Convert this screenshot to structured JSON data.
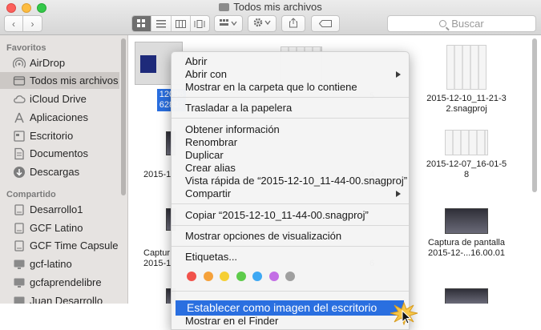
{
  "window": {
    "title": "Todos mis archivos"
  },
  "toolbar": {
    "back_icon": "chevron-left-icon",
    "forward_icon": "chevron-right-icon",
    "views": [
      "icon-view-icon",
      "list-view-icon",
      "column-view-icon",
      "coverflow-view-icon"
    ],
    "arrange_icon": "arrange-icon",
    "action_icon": "gear-icon",
    "share_icon": "share-icon",
    "tag_icon": "tag-icon",
    "search_placeholder": "Buscar"
  },
  "sidebar": {
    "favorites_heading": "Favoritos",
    "favorites": [
      {
        "label": "AirDrop",
        "icon": "airdrop-icon"
      },
      {
        "label": "Todos mis archivos",
        "icon": "all-files-icon",
        "selected": true
      },
      {
        "label": "iCloud Drive",
        "icon": "cloud-icon"
      },
      {
        "label": "Aplicaciones",
        "icon": "applications-icon"
      },
      {
        "label": "Escritorio",
        "icon": "desktop-icon"
      },
      {
        "label": "Documentos",
        "icon": "documents-icon"
      },
      {
        "label": "Descargas",
        "icon": "downloads-icon"
      }
    ],
    "shared_heading": "Compartido",
    "shared": [
      {
        "label": "Desarrollo1",
        "icon": "server-icon"
      },
      {
        "label": "GCF Latino",
        "icon": "server-icon"
      },
      {
        "label": "GCF Time Capsule",
        "icon": "server-icon"
      },
      {
        "label": "gcf-latino",
        "icon": "monitor-icon"
      },
      {
        "label": "gcfaprendelibre",
        "icon": "monitor-icon"
      },
      {
        "label": "Juan Desarrollo",
        "icon": "monitor-icon"
      }
    ]
  },
  "files": {
    "selected_name_line1": "12096",
    "selected_name_line2": "62832",
    "row1_mid_fragment": "5",
    "row1_right_line1": "2015-12-10_11-21-3",
    "row1_right_line2": "2.snagproj",
    "row2_left_fragment": "2015-1",
    "row2_mid_fragment": "4",
    "row2_right_line1": "2015-12-07_16-01-5",
    "row2_right_line2": "8",
    "row3_left_line1": "Captur",
    "row3_left_line2": "2015-1",
    "row3_mid_fragment": "6",
    "row3_right_line1": "Captura de pantalla",
    "row3_right_line2": "2015-12-...16.00.01"
  },
  "context_menu": {
    "items": [
      {
        "label": "Abrir"
      },
      {
        "label": "Abrir con",
        "submenu": true
      },
      {
        "label": "Mostrar en la carpeta que lo contiene"
      },
      {
        "label": "Trasladar a la papelera"
      },
      {
        "label": "Obtener información"
      },
      {
        "label": "Renombrar"
      },
      {
        "label": "Duplicar"
      },
      {
        "label": "Crear alias"
      },
      {
        "label": "Vista rápida de “2015-12-10_11-44-00.snagproj”"
      },
      {
        "label": "Compartir",
        "submenu": true
      },
      {
        "label": "Copiar “2015-12-10_11-44-00.snagproj”"
      },
      {
        "label": "Mostrar opciones de visualización"
      },
      {
        "label": "Etiquetas..."
      },
      {
        "label": "Establecer como imagen del escritorio",
        "highlighted": true
      },
      {
        "label": "Mostrar en el Finder"
      }
    ],
    "tag_colors": [
      "#f1524b",
      "#f5a13a",
      "#f5cf34",
      "#5ecb4b",
      "#3ea8f3",
      "#c36ee5",
      "#9f9f9f"
    ],
    "highlight_color": "#2a6fe0"
  }
}
